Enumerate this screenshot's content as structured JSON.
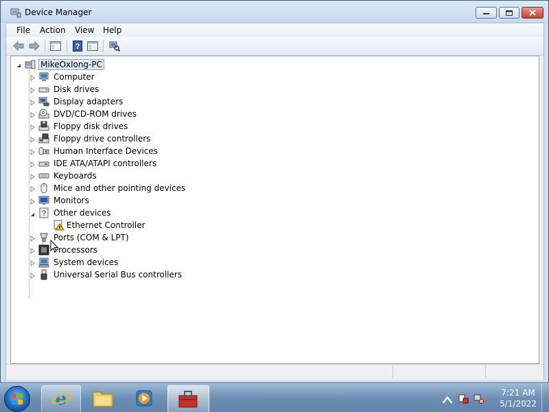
{
  "window": {
    "title": "Device Manager",
    "icon": "device-manager-icon",
    "controls": [
      "minimize-icon",
      "maximize-icon",
      "close-icon"
    ]
  },
  "menu": {
    "file": "File",
    "action": "Action",
    "view": "View",
    "help": "Help"
  },
  "toolbar": {
    "buttons": [
      "back-arrow-icon",
      "forward-arrow-icon",
      "show-hide-console-tree-icon",
      "help-icon",
      "properties-icon",
      "scan-hardware-icon"
    ]
  },
  "tree": {
    "root": "MikeOxlong-PC",
    "categories": [
      "Computer",
      "Disk drives",
      "Display adapters",
      "DVD/CD-ROM drives",
      "Floppy disk drives",
      "Floppy drive controllers",
      "Human Interface Devices",
      "IDE ATA/ATAPI controllers",
      "Keyboards",
      "Mice and other pointing devices",
      "Monitors",
      "Other devices",
      "Ports (COM & LPT)",
      "Processors",
      "System devices",
      "Universal Serial Bus controllers"
    ],
    "other_devices_children": [
      "Ethernet Controller"
    ]
  },
  "tray": {
    "time": "7:21 AM",
    "date": "5/1/2022"
  },
  "colors": {
    "warning": "#f5c400",
    "taskbar": "#6d8fb4",
    "selection": "#dbe8f7"
  }
}
